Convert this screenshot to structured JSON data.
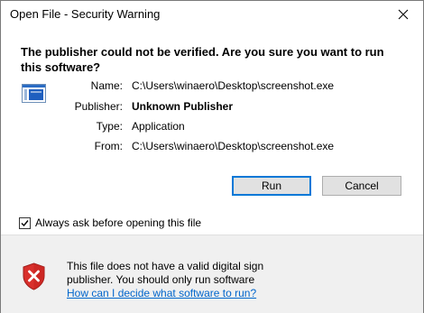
{
  "window": {
    "title": "Open File - Security Warning",
    "close_symbol": "close-icon"
  },
  "heading": "The publisher could not be verified.  Are you sure you want to run this software?",
  "details": [
    {
      "label": "Name:",
      "value": "C:\\Users\\winaero\\Desktop\\screenshot.exe",
      "bold": false
    },
    {
      "label": "Publisher:",
      "value": "Unknown Publisher",
      "bold": true
    },
    {
      "label": "Type:",
      "value": "Application",
      "bold": false
    },
    {
      "label": "From:",
      "value": "C:\\Users\\winaero\\Desktop\\screenshot.exe",
      "bold": false
    }
  ],
  "buttons": {
    "run": "Run",
    "cancel": "Cancel"
  },
  "checkbox": {
    "label": "Always ask before opening this file",
    "checked": true
  },
  "footer": {
    "line1": "This file does not have a valid digital sign",
    "line2": "publisher.  You should only run software",
    "link": "How can I decide what software to run?"
  },
  "colors": {
    "accent": "#0078d7",
    "link": "#0066cc",
    "shield_red": "#d9302c"
  }
}
